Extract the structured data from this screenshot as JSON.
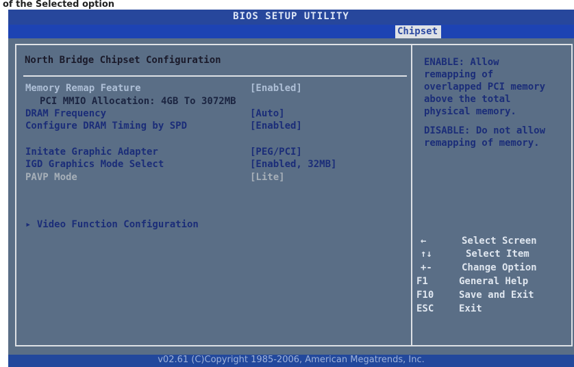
{
  "caption": "of the Selected option",
  "title": "BIOS SETUP UTILITY",
  "active_tab": "Chipset",
  "section_title": "North Bridge Chipset Configuration",
  "settings": [
    {
      "label": "Memory Remap Feature",
      "value": "[Enabled]"
    },
    {
      "label": "PCI MMIO Allocation: 4GB To 3072MB",
      "value": ""
    },
    {
      "label": "DRAM Frequency",
      "value": "[Auto]"
    },
    {
      "label": "Configure DRAM Timing by SPD",
      "value": "[Enabled]"
    },
    {
      "label": "Initate Graphic Adapter",
      "value": "[PEG/PCI]"
    },
    {
      "label": "IGD Graphics Mode Select",
      "value": "[Enabled, 32MB]"
    },
    {
      "label": "PAVP Mode",
      "value": "[Lite]"
    }
  ],
  "submenu": "▸ Video Function Configuration",
  "help": {
    "enable_text": "ENABLE: Allow\nremapping of\noverlapped PCI memory\nabove the total\nphysical memory.",
    "disable_text": "DISABLE: Do not allow\nremapping of memory."
  },
  "keys": [
    {
      "key": "←",
      "desc": "Select Screen"
    },
    {
      "key": "↑↓",
      "desc": "Select Item"
    },
    {
      "key": "+-",
      "desc": "Change Option"
    },
    {
      "key": "F1",
      "desc": "General Help"
    },
    {
      "key": "F10",
      "desc": "Save and Exit"
    },
    {
      "key": "ESC",
      "desc": "Exit"
    }
  ],
  "footer": "v02.61 (C)Copyright 1985-2006, American Megatrends, Inc."
}
